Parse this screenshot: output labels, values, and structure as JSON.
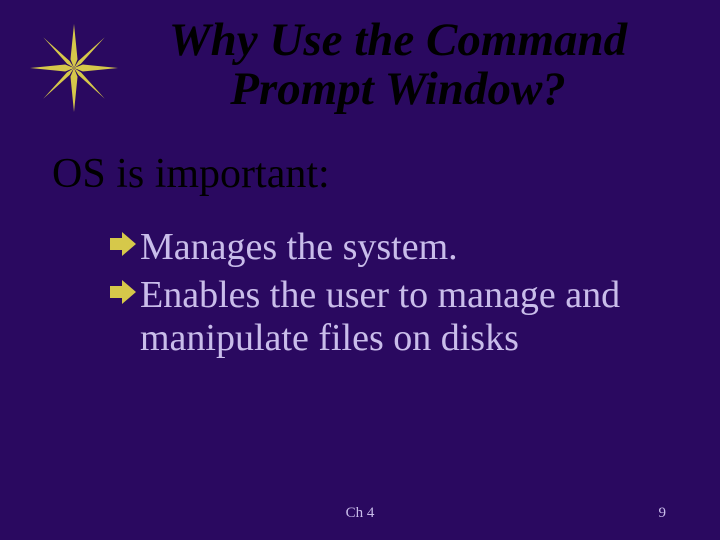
{
  "title": "Why Use the Command Prompt Window?",
  "subtitle": "OS is important:",
  "bullets": [
    "Manages the system.",
    "Enables the user to manage and manipulate files on disks"
  ],
  "footer": {
    "center": "Ch 4",
    "page": "9"
  },
  "colors": {
    "bg": "#2a0960",
    "body_text": "#c9bdea",
    "accent": "#d6c84a"
  }
}
